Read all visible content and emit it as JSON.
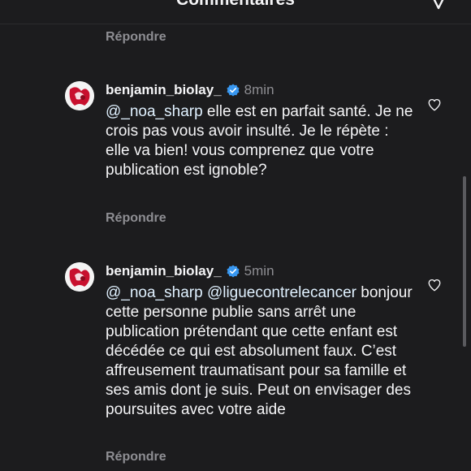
{
  "header": {
    "title": "Commentaires",
    "filter_icon": "filter-icon"
  },
  "reply_label": "Répondre",
  "comments": [
    {
      "username": "benjamin_biolay_",
      "verified_icon": "verified-badge-icon",
      "time": "8min",
      "mentions": [
        "@_noa_sharp"
      ],
      "text": " elle est en parfait santé. Je ne crois pas vous avoir insulté. Je le répète : elle va bien! vous comprenez que votre publication est ignoble?",
      "like_icon": "heart-outline-icon"
    },
    {
      "username": "benjamin_biolay_",
      "verified_icon": "verified-badge-icon",
      "time": "5min",
      "mentions": [
        "@_noa_sharp",
        "@liguecontrelecancer"
      ],
      "text": "bonjour cette personne publie sans arrêt une publication prétendant que cette enfant est décédée ce qui est absolument faux. C’est affreusement traumatisant pour sa famille et ses amis dont je suis. Peut on envisager des poursuites avec votre aide",
      "like_icon": "heart-outline-icon"
    }
  ],
  "colors": {
    "background": "#1c1c1e",
    "text": "#f5f5f7",
    "secondary": "#8e8e93",
    "mention": "#e0f1ff",
    "verified": "#3897f0"
  }
}
